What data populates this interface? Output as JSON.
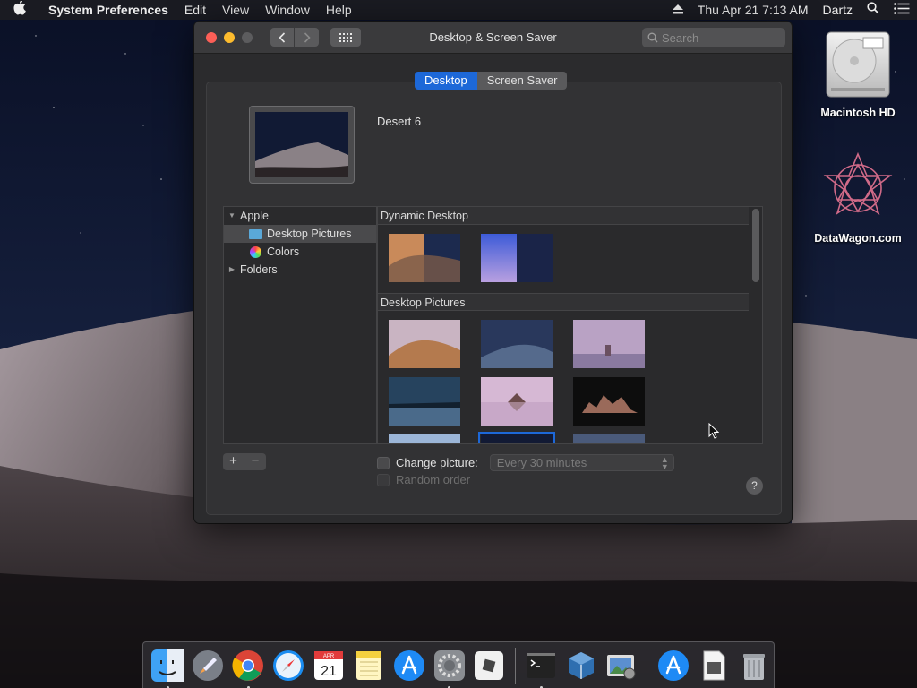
{
  "menubar": {
    "app": "System Preferences",
    "menus": [
      "Edit",
      "View",
      "Window",
      "Help"
    ],
    "clock": "Thu Apr 21  7:13 AM",
    "user": "Dartz"
  },
  "desktop_icons": {
    "hd_label": "Macintosh HD",
    "dw_label": "DataWagon.com"
  },
  "window": {
    "title": "Desktop & Screen Saver",
    "search_placeholder": "Search",
    "tabs": {
      "desktop": "Desktop",
      "screen_saver": "Screen Saver",
      "selected": "Desktop"
    },
    "current_picture": "Desert 6",
    "sources": {
      "apple": "Apple",
      "desktop_pictures": "Desktop Pictures",
      "colors": "Colors",
      "folders": "Folders"
    },
    "sections": {
      "dynamic": "Dynamic Desktop",
      "pictures": "Desktop Pictures"
    },
    "change_picture_label": "Change picture:",
    "change_interval": "Every 30 minutes",
    "random_order_label": "Random order",
    "help": "?",
    "plus": "+",
    "minus": "−"
  },
  "dock": {
    "calendar_month": "APR",
    "calendar_day": "21"
  },
  "colors": {
    "accent": "#1d68d8",
    "close": "#fc5f57",
    "minimize": "#fdbc2e"
  }
}
